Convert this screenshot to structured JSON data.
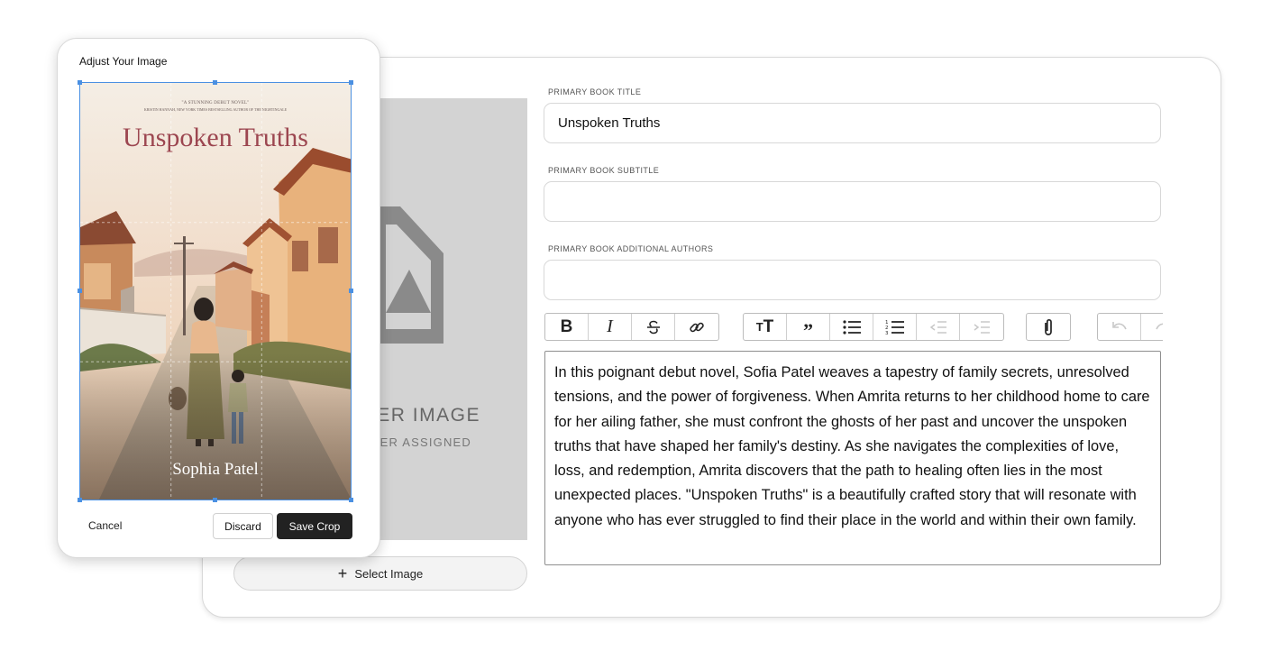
{
  "cover_placeholder": {
    "title": "COVER IMAGE",
    "title_visible": "VER IMAGE",
    "subtitle_visible": "VER ASSIGNED",
    "select_button_label": "Select Image"
  },
  "fields": [
    {
      "label": "PRIMARY BOOK TITLE",
      "value": "Unspoken Truths"
    },
    {
      "label": "PRIMARY BOOK SUBTITLE",
      "value": ""
    },
    {
      "label": "PRIMARY BOOK ADDITIONAL AUTHORS",
      "value": ""
    }
  ],
  "toolbar": {
    "groups": [
      [
        "bold-icon",
        "italic-icon",
        "strikethrough-icon",
        "link-icon"
      ],
      [
        "heading-icon",
        "quote-icon",
        "bullet-list-icon",
        "numbered-list-icon",
        "outdent-icon",
        "indent-icon"
      ],
      [
        "attachment-icon"
      ],
      [
        "undo-icon",
        "redo-icon"
      ]
    ]
  },
  "description": "In this poignant debut novel, Sofia Patel weaves a tapestry of family secrets, unresolved tensions, and the power of forgiveness. When Amrita returns to her childhood home to care for her ailing father, she must confront the ghosts of her past and uncover the unspoken truths that have shaped her family's destiny. As she navigates the complexities of love, loss, and redemption, Amrita discovers that the path to healing often lies in the most unexpected places. \"Unspoken Truths\" is a beautifully crafted story that will resonate with anyone who has ever struggled to find their place in the world and within their own family.",
  "crop_modal": {
    "title": "Adjust Your Image",
    "cancel_label": "Cancel",
    "discard_label": "Discard",
    "save_label": "Save Crop",
    "cover": {
      "blurb": "\"A STUNNING DEBUT NOVEL\"",
      "endorsement": "KRISTIN HANNAH, NEW YORK TIMES BESTSELLING AUTHOR OF THE NIGHTINGALE",
      "title": "Unspoken Truths",
      "author": "Sophia Patel"
    }
  },
  "colors": {
    "accent_blue": "#4a90e2",
    "save_button": "#222222",
    "cover_title": "#9c4650",
    "placeholder_bg": "#d3d3d3"
  }
}
